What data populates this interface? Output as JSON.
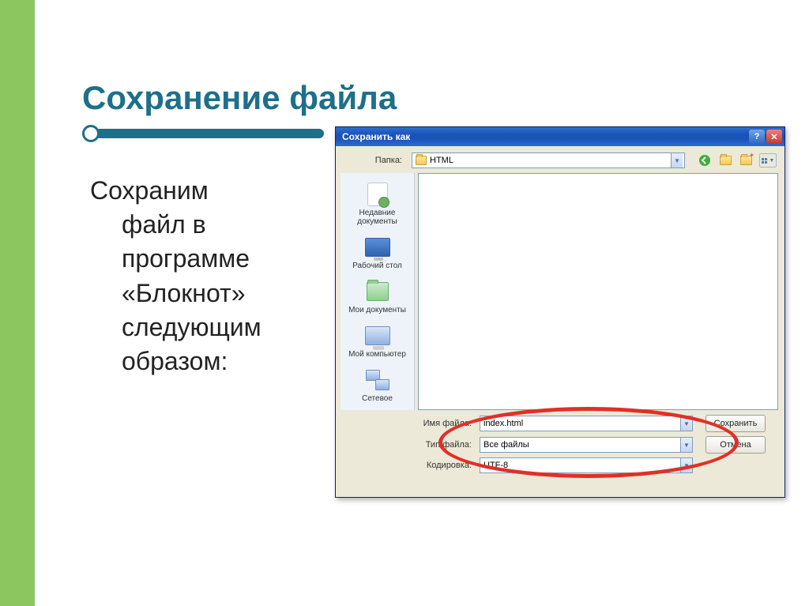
{
  "slide": {
    "title": "Сохранение файла",
    "body_line1": "Сохраним",
    "body_rest": "файл в программе «Блокнот» следующим образом:"
  },
  "dialog": {
    "title": "Сохранить как",
    "lookin_label": "Папка:",
    "lookin_value": "HTML",
    "places": {
      "recent": "Недавние документы",
      "desktop": "Рабочий стол",
      "mydocs": "Мои документы",
      "mycomp": "Мой компьютер",
      "network": "Сетевое"
    },
    "filename_label": "Имя файла:",
    "filename_value": "index.html",
    "filetype_label": "Тип файла:",
    "filetype_value": "Все файлы",
    "encoding_label": "Кодировка:",
    "encoding_value": "UTF-8",
    "save_button": "Сохранить",
    "cancel_button": "Отмена"
  }
}
